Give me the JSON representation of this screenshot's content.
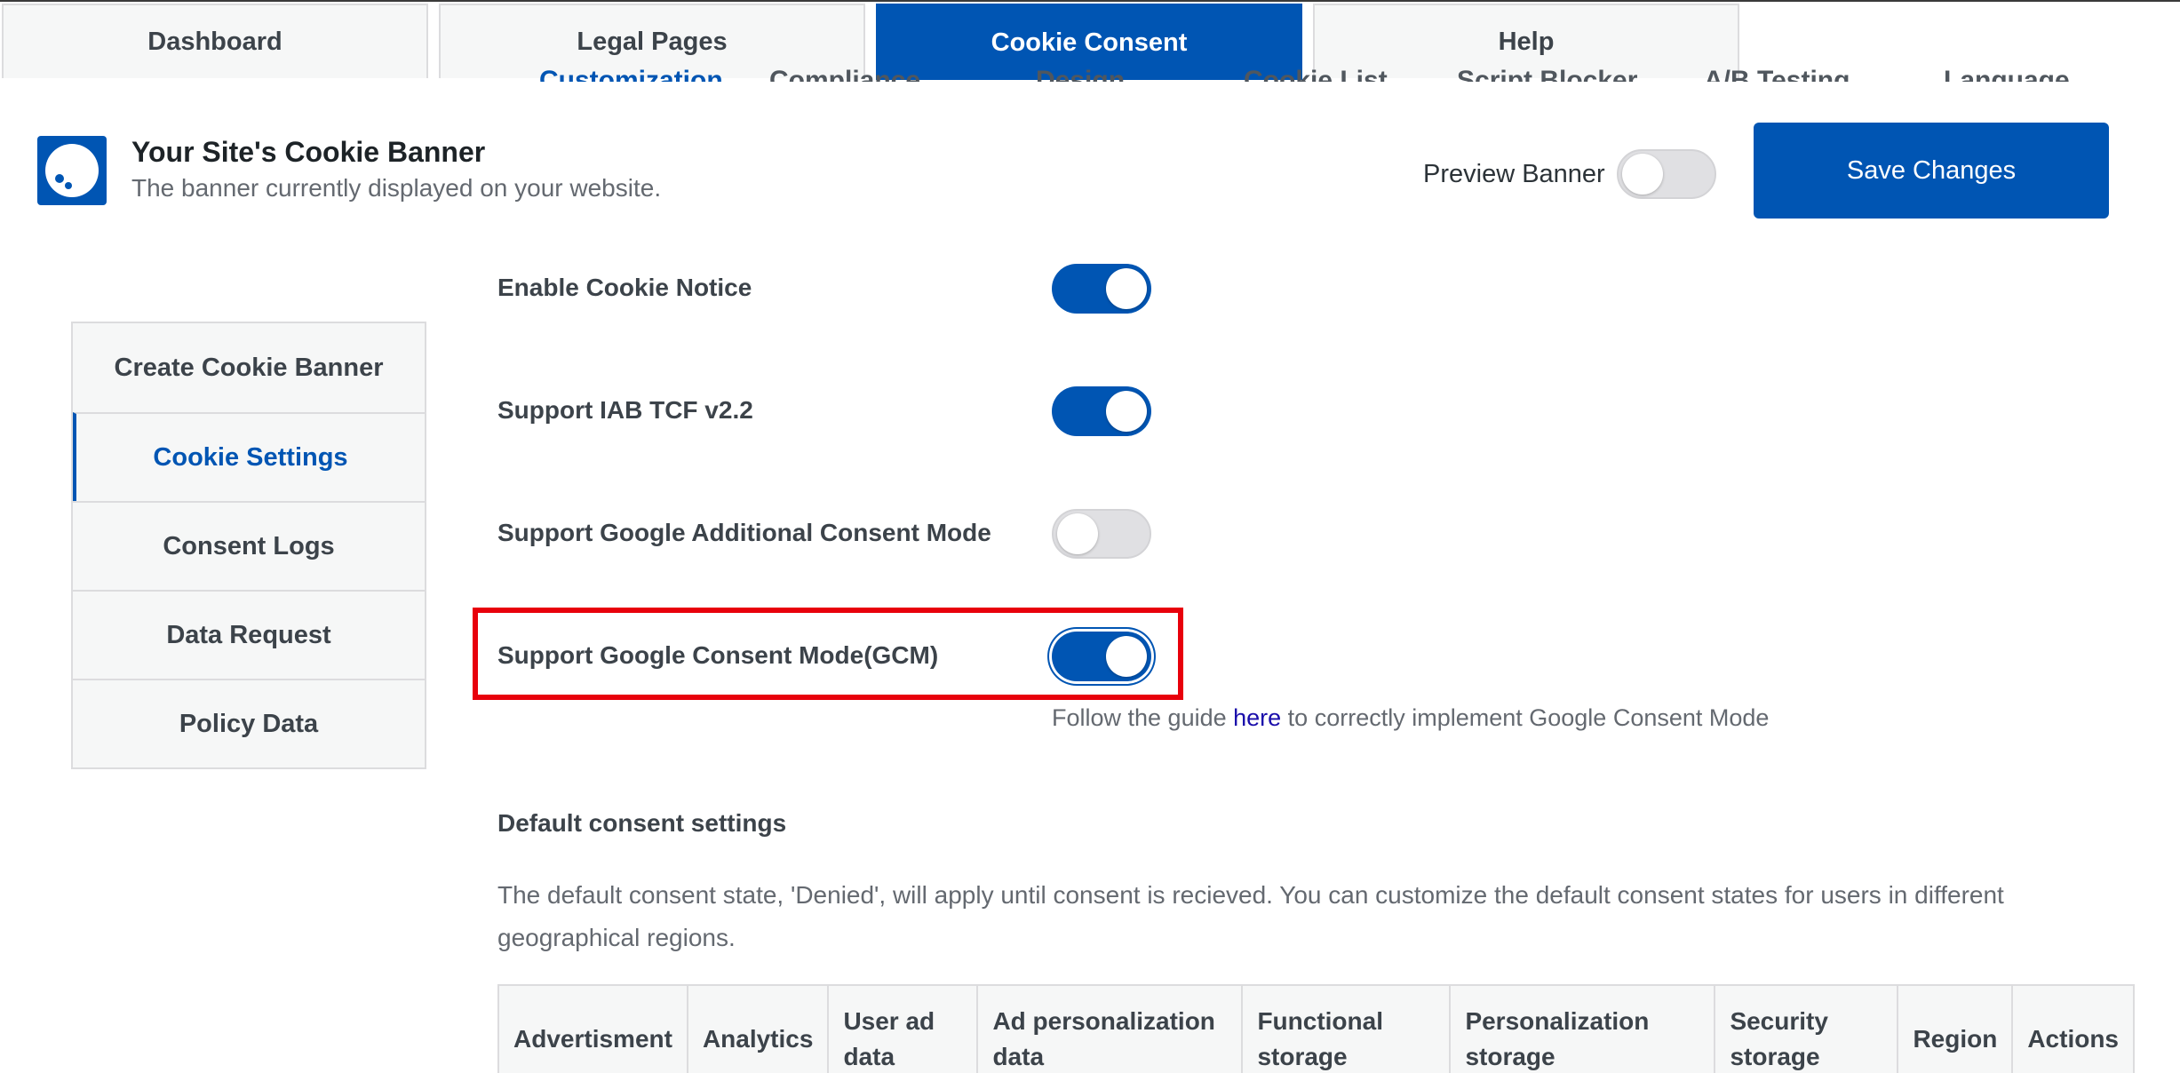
{
  "top_tabs": [
    {
      "label": "Dashboard",
      "active": false
    },
    {
      "label": "Legal Pages",
      "active": false
    },
    {
      "label": "Cookie Consent",
      "active": true
    },
    {
      "label": "Help",
      "active": false
    }
  ],
  "sub_tabs": [
    "Customization",
    "Compliance",
    "Design",
    "Cookie List",
    "Script Blocker",
    "A/B Testing",
    "Language"
  ],
  "banner": {
    "title": "Your Site's Cookie Banner",
    "subtitle": "The banner currently displayed on your website.",
    "preview_label": "Preview Banner",
    "preview_on": false,
    "save_label": "Save Changes"
  },
  "left_nav": [
    {
      "label": "Create Cookie Banner",
      "active": false
    },
    {
      "label": "Cookie Settings",
      "active": true
    },
    {
      "label": "Consent Logs",
      "active": false
    },
    {
      "label": "Data Request",
      "active": false
    },
    {
      "label": "Policy Data",
      "active": false
    }
  ],
  "settings": [
    {
      "label": "Enable Cookie Notice",
      "enabled": true
    },
    {
      "label": "Support IAB TCF v2.2",
      "enabled": true
    },
    {
      "label": "Support Google Additional Consent Mode",
      "enabled": false
    },
    {
      "label": "Support Google Consent Mode(GCM)",
      "enabled": true,
      "highlighted": true
    }
  ],
  "guide": {
    "prefix": "Follow the guide ",
    "link": "here",
    "suffix": " to correctly implement Google Consent Mode"
  },
  "default_consent": {
    "title": "Default consent settings",
    "description": "The default consent state, 'Denied', will apply until consent is recieved. You can customize the default consent states for users in different geographical regions.",
    "columns": [
      "Advertisment",
      "Analytics",
      "User ad data",
      "Ad personalization data",
      "Functional storage",
      "Personalization storage",
      "Security storage",
      "Region",
      "Actions"
    ]
  },
  "colors": {
    "accent": "#0055b3",
    "highlight_border": "#e8000b",
    "link": "#1a0dab"
  }
}
